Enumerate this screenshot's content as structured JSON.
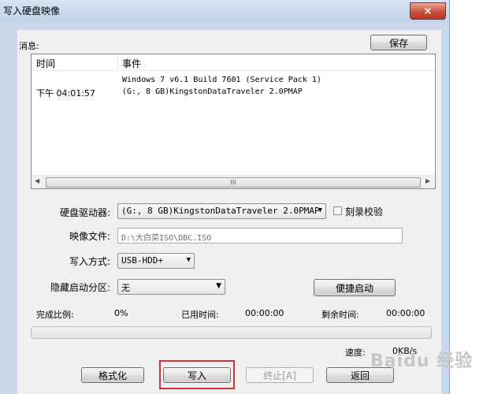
{
  "window": {
    "title": "写入硬盘映像",
    "close_symbol": "×"
  },
  "messages": {
    "label": "消息:",
    "save_button": "保存",
    "columns": [
      "时间",
      "事件"
    ],
    "rows": [
      {
        "time": "",
        "event": "Windows 7 v6.1 Build 7601 (Service Pack 1)"
      },
      {
        "time": "下午 04:01:57",
        "event": "(G:, 8 GB)KingstonDataTraveler 2.0PMAP"
      }
    ],
    "scroll_thumb_glyph": "III"
  },
  "form": {
    "drive_label": "硬盘驱动器:",
    "drive_value": "(G:, 8 GB)KingstonDataTraveler 2.0PMAP",
    "verify_label": "刻录校验",
    "verify_checked": false,
    "image_label": "映像文件:",
    "image_value": "D:\\大白菜ISO\\DBC.ISO",
    "method_label": "写入方式:",
    "method_value": "USB-HDD+",
    "hidden_label": "隐藏启动分区:",
    "hidden_value": "无",
    "easy_boot_button": "便捷启动"
  },
  "status": {
    "completion_label": "完成比例:",
    "completion_value": "0%",
    "progress_fraction": 0,
    "elapsed_label": "已用时间:",
    "elapsed_value": "00:00:00",
    "remaining_label": "剩余时间:",
    "remaining_value": "00:00:00",
    "speed_label": "速度:",
    "speed_value": "0KB/s"
  },
  "buttons": {
    "format": "格式化",
    "write": "写入",
    "stop": "终止[A]",
    "back": "返回"
  },
  "watermark": "Baidu 经验",
  "colors": {
    "progress_green": "#06b025",
    "highlight_red": "#d63031"
  }
}
